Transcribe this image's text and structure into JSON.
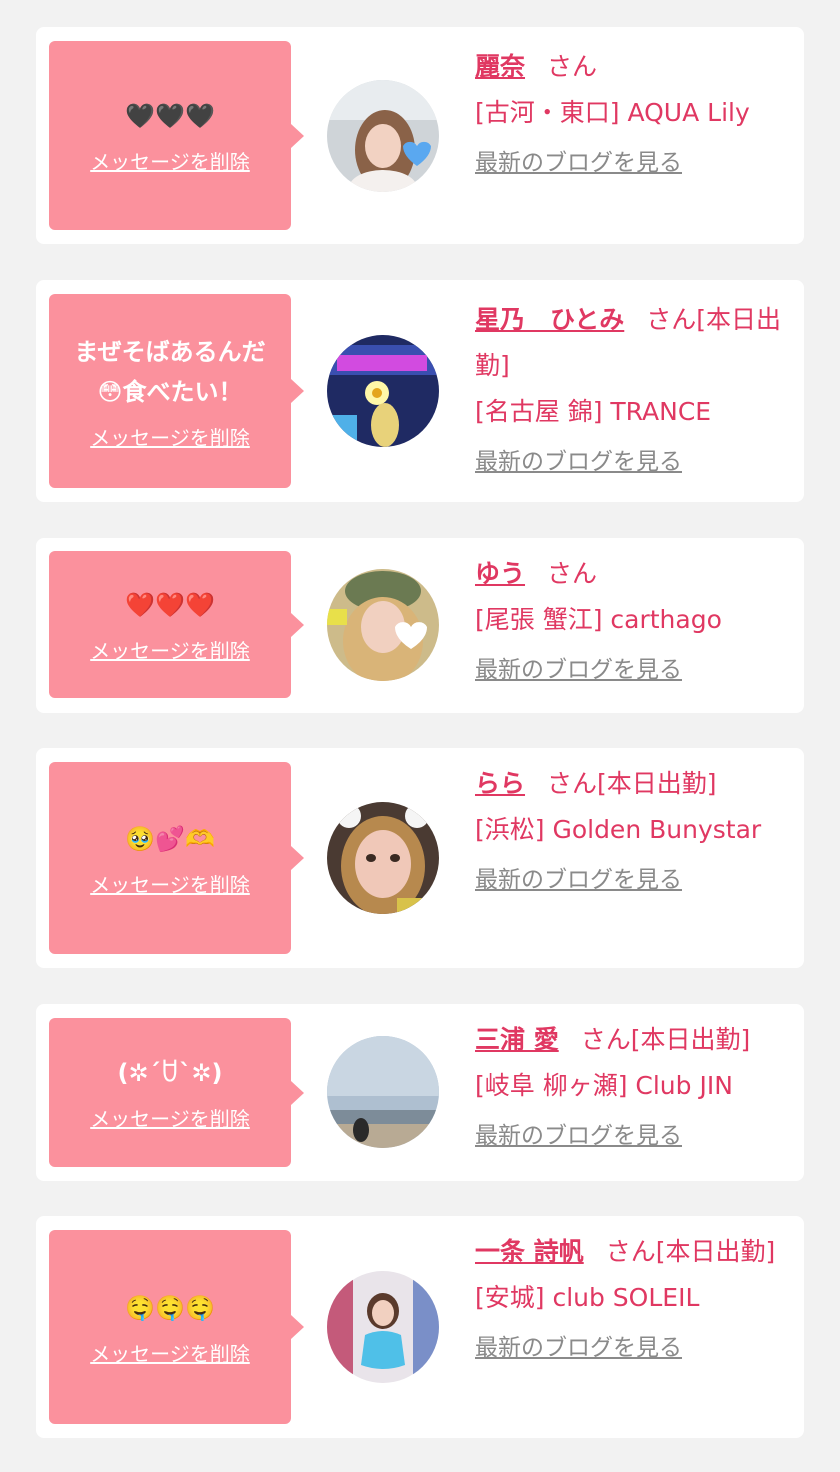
{
  "colors": {
    "bubble": "#fb919d",
    "accent": "#e03862",
    "link_gray": "#8a8a8a",
    "background": "#f2f2f2"
  },
  "delete_label": "メッセージを削除",
  "blog_label": "最新のブログを見る",
  "san_suffix": "さん",
  "items": [
    {
      "message": "🖤🖤🖤",
      "name": "麗奈",
      "badge": "",
      "shop": "[古河・東口] AQUA Lily",
      "avatar_icon": "avatar-photo"
    },
    {
      "message": "まぜそばあるんだ\n😳食べたい！",
      "name": "星乃　ひとみ",
      "badge": "[本日出勤]",
      "shop": "[名古屋 錦] TRANCE",
      "avatar_icon": "avatar-photo"
    },
    {
      "message": "❤️❤️❤️",
      "name": "ゆう",
      "badge": "",
      "shop": "[尾張 蟹江] carthago",
      "avatar_icon": "avatar-photo"
    },
    {
      "message": "🥹💕🫶",
      "name": "らら",
      "badge": "[本日出勤]",
      "shop": "[浜松] Golden Bunystar",
      "avatar_icon": "avatar-photo"
    },
    {
      "message": "(✲´ꇴ`✲)",
      "name": "三浦 愛",
      "badge": "[本日出勤]",
      "shop": "[岐阜 柳ヶ瀬] Club JIN",
      "avatar_icon": "avatar-photo"
    },
    {
      "message": "🤤🤤🤤",
      "name": "一条 詩帆",
      "badge": "[本日出勤]",
      "shop": "[安城] club SOLEIL",
      "avatar_icon": "avatar-photo"
    }
  ]
}
